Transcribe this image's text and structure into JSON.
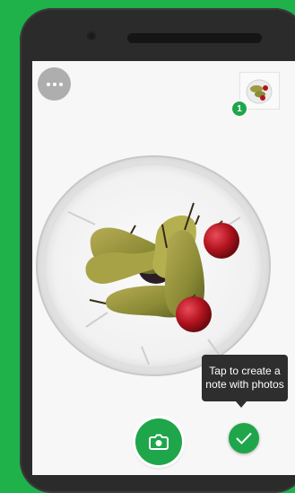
{
  "toolbar": {
    "more_icon": "more-horizontal-icon"
  },
  "thumbnail": {
    "count": "1",
    "subject": "fruit bowl photo"
  },
  "tooltip": {
    "text": "Tap to create a note with photos"
  },
  "controls": {
    "capture_icon": "camera-icon",
    "done_icon": "checkmark-icon"
  },
  "colors": {
    "accent": "#1fa64a",
    "background": "#1fb24a",
    "tooltip_bg": "#2e2e2e"
  }
}
